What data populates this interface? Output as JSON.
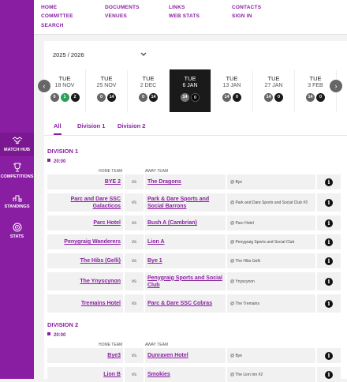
{
  "nav": {
    "home": "HOME",
    "documents": "DOCUMENTS",
    "links": "LINKS",
    "contacts": "CONTACTS",
    "committee": "COMMITTEE",
    "venues": "VENUES",
    "web_stats": "WEB STATS",
    "sign_in": "SIGN IN",
    "search": "SEARCH"
  },
  "sidebar": {
    "match_hub": "MATCH HUB",
    "competitions": "COMPETITIONS",
    "standings": "STANDINGS",
    "stats": "STATS"
  },
  "season": {
    "selected": "2025 / 2026"
  },
  "dates": [
    {
      "day": "TUE",
      "date": "18 NOV",
      "pills": [
        {
          "v": "0",
          "c": "g"
        },
        {
          "v": "1",
          "c": "gr"
        },
        {
          "v": "2",
          "c": "b"
        }
      ]
    },
    {
      "day": "TUE",
      "date": "25 NOV",
      "pills": [
        {
          "v": "0",
          "c": "g"
        },
        {
          "v": "14",
          "c": "b"
        }
      ]
    },
    {
      "day": "TUE",
      "date": "2 DEC",
      "pills": [
        {
          "v": "0",
          "c": "g"
        },
        {
          "v": "14",
          "c": "b"
        }
      ]
    },
    {
      "day": "TUE",
      "date": "6 JAN",
      "pills": [
        {
          "v": "14",
          "c": "g"
        },
        {
          "v": "0",
          "c": "b"
        }
      ],
      "selected": true
    },
    {
      "day": "TUE",
      "date": "13 JAN",
      "pills": [
        {
          "v": "14",
          "c": "g"
        },
        {
          "v": "0",
          "c": "b"
        }
      ]
    },
    {
      "day": "TUE",
      "date": "27 JAN",
      "pills": [
        {
          "v": "14",
          "c": "g"
        },
        {
          "v": "0",
          "c": "b"
        }
      ]
    },
    {
      "day": "TUE",
      "date": "3 FEB",
      "pills": [
        {
          "v": "14",
          "c": "g"
        },
        {
          "v": "0",
          "c": "b"
        }
      ]
    }
  ],
  "tabs": {
    "all": "All",
    "division1": "Division 1",
    "division2": "Division 2"
  },
  "col_headers": {
    "home": "HOME TEAM",
    "away": "AWAY TEAM"
  },
  "vs": "vs",
  "divisions": [
    {
      "title": "DIVISION 1",
      "time": "20:00",
      "fixtures": [
        {
          "home": "BYE 2",
          "away": "The Dragons",
          "venue": "@ Bye"
        },
        {
          "home": "Parc and Dare SSC Galacticos",
          "away": "Park & Dare Sports and Social Barrons",
          "venue": "@ Park and Dare Sports and Social Club #3"
        },
        {
          "home": "Parc Hotel",
          "away": "Bush A (Cambrian)",
          "venue": "@ Parc Hotel"
        },
        {
          "home": "Penygraig Wanderers",
          "away": "Lion A",
          "venue": "@ Penygraig Sports and Social Club"
        },
        {
          "home": "The Hibs (Gelli)",
          "away": "Bye 1",
          "venue": "@ The Hibs Gelli"
        },
        {
          "home": "The Ynyscynon",
          "away": "Penygraig Sports and Social Club",
          "venue": "@ Ynyscynon"
        },
        {
          "home": "Tremains Hotel",
          "away": "Parc & Dare SSC Cobras",
          "venue": "@ The Tremains"
        }
      ]
    },
    {
      "title": "DIVISION 2",
      "time": "20:00",
      "fixtures": [
        {
          "home": "Bye3",
          "away": "Dunraven Hotel",
          "venue": "@ Bye"
        },
        {
          "home": "Lion B",
          "away": "Smokies",
          "venue": "@ The Lion Inn #2"
        }
      ]
    }
  ],
  "colors": {
    "brand": "#8a1ea2",
    "selected_date": "#1a1a1a",
    "green": "#2aa05a"
  }
}
